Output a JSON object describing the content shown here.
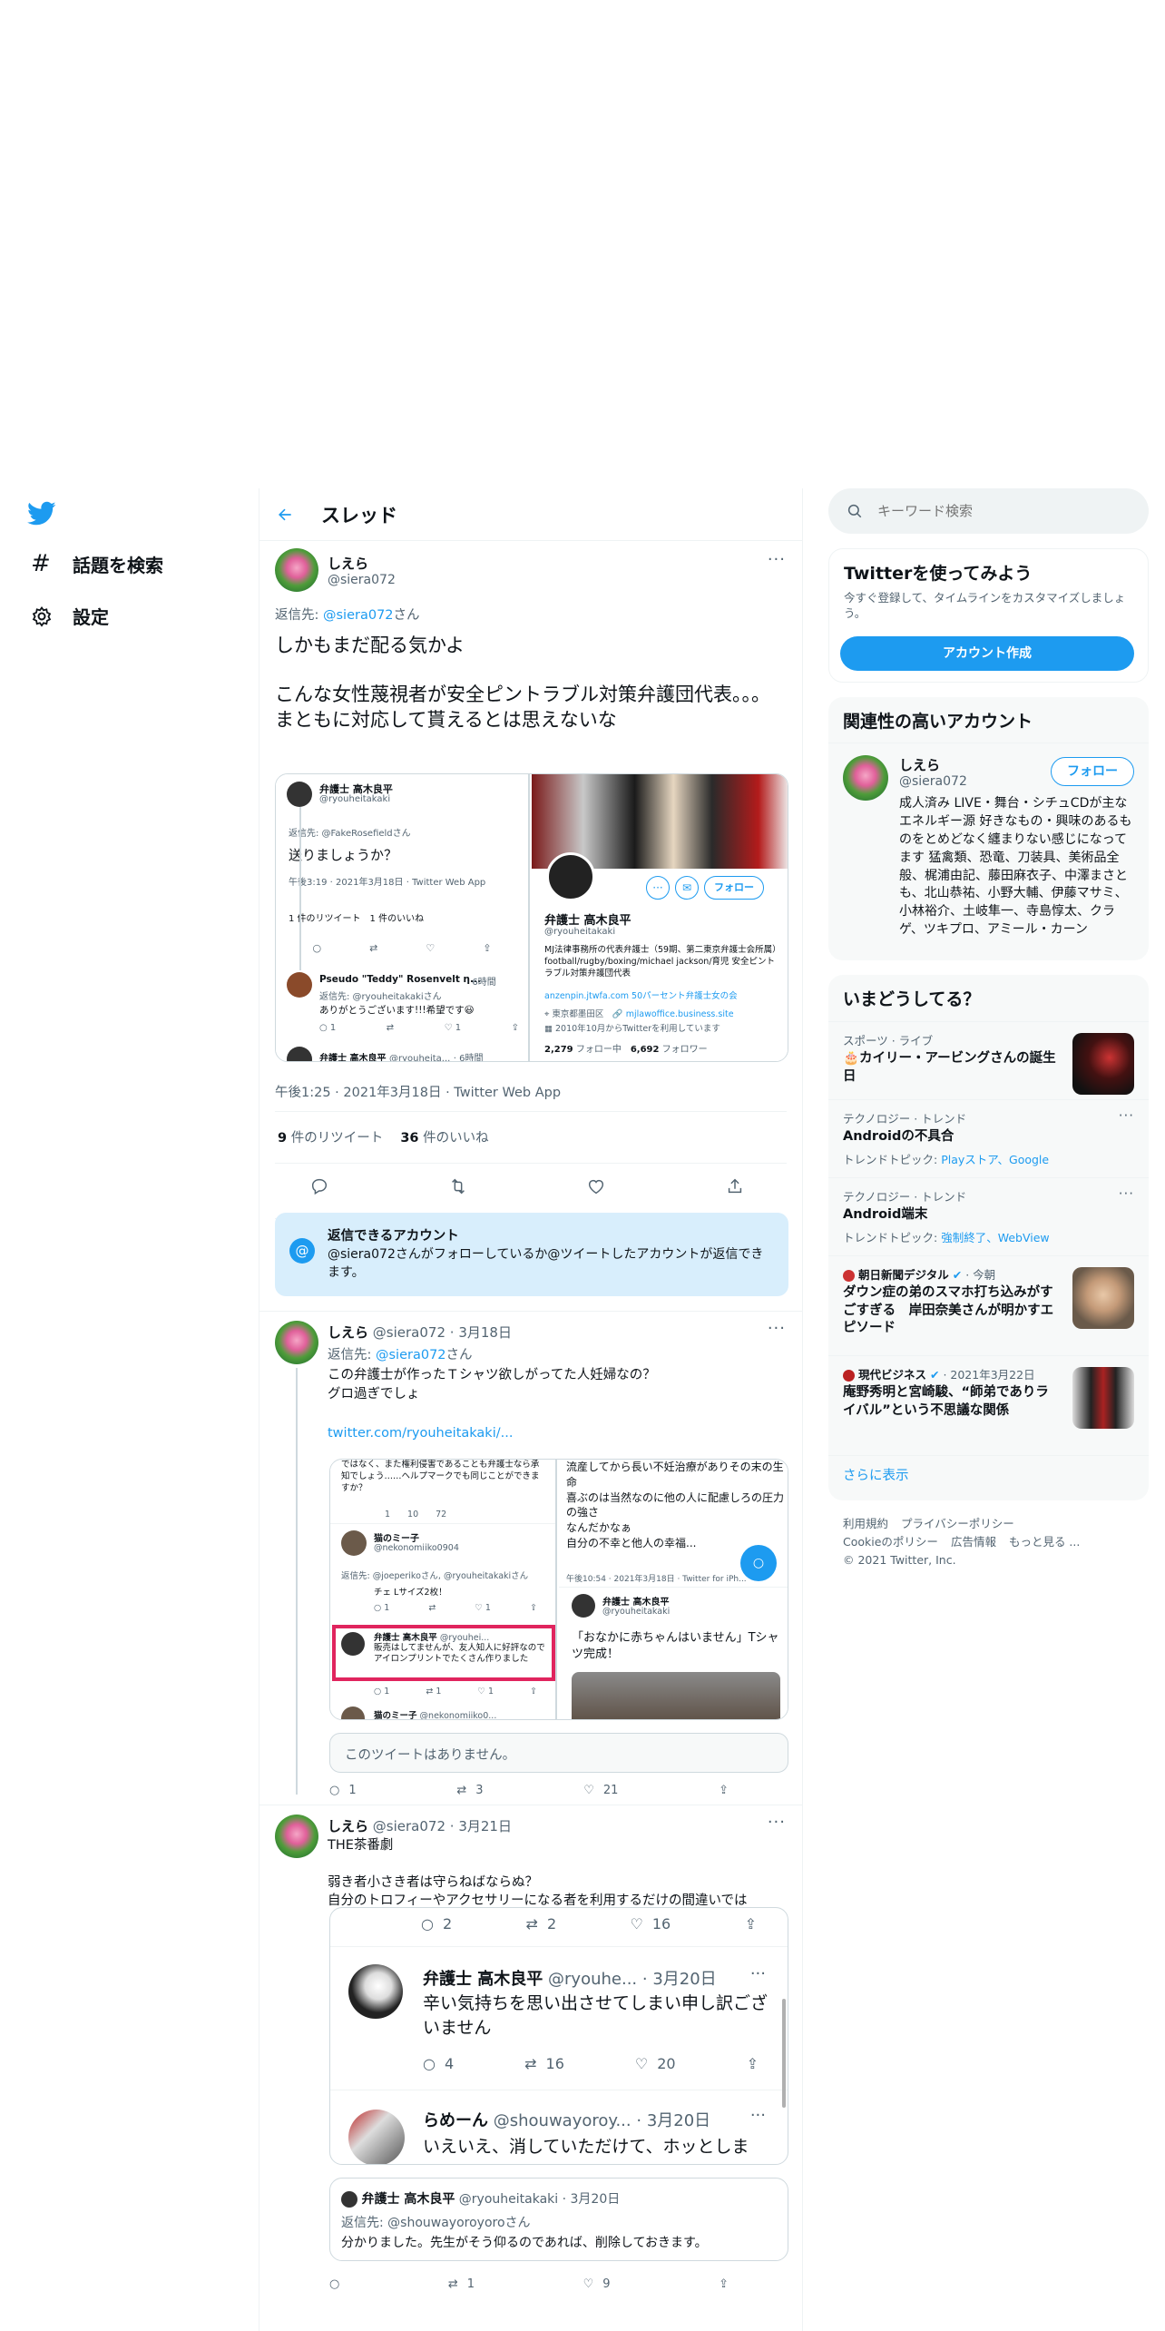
{
  "nav": {
    "explore": "話題を検索",
    "settings": "設定"
  },
  "header": {
    "title": "スレッド"
  },
  "main_tweet": {
    "name": "しえら",
    "handle": "@siera072",
    "reply_prefix": "返信先: ",
    "reply_to": "@siera072",
    "reply_suffix": "さん",
    "text_line1": "しかもまだ配る気かよ",
    "text_line2": "こんな女性蔑視者が安全ピントラブル対策弁護団代表。。。",
    "text_line3": "まともに対応して貰えるとは思えないな",
    "timestamp": "午後1:25 · 2021年3月18日 · Twitter Web App",
    "retweets": "9",
    "retweets_label": "件のリツイート",
    "likes": "36",
    "likes_label": "件のいいね",
    "embedded": {
      "left": {
        "name": "弁護士 高木良平",
        "handle": "@ryouheitakaki",
        "reply": "返信先: @FakeRosefieldさん",
        "text": "送りましょうか？",
        "time": "午後3:19 · 2021年3月18日 · Twitter Web App",
        "stats": "1 件のリツイート　1 件のいいね",
        "reply2_name": "Pseudo \"Teddy\" Rosenvelt η...",
        "reply2_time": "· 6時間",
        "reply2_reply": "返信先: @ryouheitakakiさん",
        "reply2_text": "ありがとうございます!!!希望です😃",
        "reply3_name": "弁護士 高木良平",
        "reply3_handle": "@ryouheita...",
        "reply3_time": "· 6時間"
      },
      "right": {
        "follow": "フォロー",
        "name": "弁護士 高木良平",
        "handle": "@ryouheitakaki",
        "bio": "MJ法律事務所の代表弁護士（59期、第二東京弁護士会所属）football/rugby/boxing/michael jackson/育児 安全ピントラブル対策弁護団代表",
        "links": "anzenpin.jtwfa.com 50パーセント弁護士女の会",
        "location": "東京都墨田区",
        "site": "mjlawoffice.business.site",
        "joined": "2010年10月からTwitterを利用しています",
        "following": "2,279",
        "following_label": "フォロー中",
        "followers": "6,692",
        "followers_label": "フォロワー"
      }
    }
  },
  "reply_notice": {
    "title": "返信できるアカウント",
    "text": "@siera072さんがフォローしているか@ツイートしたアカウントが返信できます。"
  },
  "reply1": {
    "name": "しえら",
    "handle": "@siera072",
    "date": "· 3月18日",
    "reply_prefix": "返信先: ",
    "reply_to": "@siera072",
    "reply_suffix": "さん",
    "text1": "この弁護士が作ったＴシャツ欲しがってた人妊婦なの？",
    "text2": "グロ過ぎでしょ",
    "link": "twitter.com/ryouheitakaki/...",
    "embed": {
      "left_top": "ではなく、また権利侵害であることも弁護士なら承知でしょう……ヘルプマークでも同じことができますか？",
      "left_stats": "1　　10　　72",
      "user2_name": "猫のミー子",
      "user2_handle": "@nekonomiiko0904",
      "user2_reply": "返信先: @joeperikoさん, @ryouheitakakiさん",
      "user2_text": "チェ Lサイズ2枚！",
      "highlight_name": "弁護士 高木良平",
      "highlight_handle": "@ryouhei...",
      "highlight_text": "販売はしてませんが、友人知人に好評なのでアイロンプリントでたくさん作りました",
      "bottom_name": "猫のミー子",
      "bottom_handle": "@nekonomiiko0...",
      "right_top1": "流産してから長い不妊治療がありその末の生命",
      "right_top2": "喜ぶのは当然なのに他の人に配慮しろの圧力の強さ",
      "right_top3": "なんだかなぁ",
      "right_top4": "自分の不幸と他人の幸福...",
      "right_time": "午後10:54 · 2021年3月18日 · Twitter for iPh...",
      "right_name": "弁護士 高木良平",
      "right_handle": "@ryouheitakaki",
      "right_text": "「おなかに赤ちゃんはいません」Tシャツ完成！"
    },
    "unavailable": "このツイートはありません。",
    "replies": "1",
    "retweets": "3",
    "likes": "21"
  },
  "reply2": {
    "name": "しえら",
    "handle": "@siera072",
    "date": "· 3月21日",
    "text1": "THE茶番劇",
    "text2": "弱き者小さき者は守らねばならぬ？",
    "text3": "自分のトロフィーやアクセサリーになる者を利用するだけの間違いでは",
    "embed": {
      "top_replies": "2",
      "top_retweets": "2",
      "top_likes": "16",
      "t1_name": "弁護士 高木良平",
      "t1_handle": "@ryouhe...",
      "t1_date": "· 3月20日",
      "t1_text": "辛い気持ちを思い出させてしまい申し訳ございません",
      "t1_replies": "4",
      "t1_retweets": "16",
      "t1_likes": "20",
      "t2_name": "らめーん",
      "t2_handle": "@shouwayoroy...",
      "t2_date": "· 3月20日",
      "t2_text": "いえいえ、消していただけて、ホッとしま"
    },
    "quote": {
      "name": "弁護士 高木良平",
      "handle": "@ryouheitakaki",
      "date": "· 3月20日",
      "reply": "返信先: @shouwayoroyoroさん",
      "text": "分かりました。先生がそう仰るのであれば、削除しておきます。"
    },
    "retweets": "1",
    "likes": "9"
  },
  "search": {
    "placeholder": "キーワード検索"
  },
  "signup": {
    "title": "Twitterを使ってみよう",
    "text": "今すぐ登録して、タイムラインをカスタマイズしましょう。",
    "button": "アカウント作成"
  },
  "relevant": {
    "title": "関連性の高いアカウント",
    "name": "しえら",
    "handle": "@siera072",
    "follow": "フォロー",
    "bio": "成人済み LIVE・舞台・シチュCDが主なエネルギー源 好きなもの・興味のあるものをとめどなく纏まりない感じになってます 猛禽類、恐竜、刀装具、美術品全般、梶浦由記、藤田麻衣子、中澤まさとも、北山恭祐、小野大輔、伊藤マサミ、小林裕介、土岐隼一、寺島惇太、クラゲ、ツキプロ、アミール・カーン"
  },
  "trends": {
    "title": "いまどうしてる？",
    "items": [
      {
        "meta": "スポーツ · ライブ",
        "name": "🎂カイリー・アービングさんの誕生日"
      },
      {
        "meta": "テクノロジー · トレンド",
        "name": "Androidの不具合",
        "sub_prefix": "トレンドトピック: ",
        "sub": "Playストア、Google"
      },
      {
        "meta": "テクノロジー · トレンド",
        "name": "Android端末",
        "sub_prefix": "トレンドトピック: ",
        "sub": "強制終了、WebView"
      },
      {
        "source": "朝日新聞デジタル",
        "meta": "· 今朝",
        "name": "ダウン症の弟のスマホ打ち込みがすごすぎる　岸田奈美さんが明かすエピソード"
      },
      {
        "source": "現代ビジネス",
        "meta": "· 2021年3月22日",
        "name": "庵野秀明と宮崎駿、“師弟でありライバル”という不思議な関係"
      }
    ],
    "more": "さらに表示"
  },
  "footer": {
    "terms": "利用規約",
    "privacy": "プライバシーポリシー",
    "cookie": "Cookieのポリシー",
    "ads": "広告情報",
    "more": "もっと見る ...",
    "copyright": "© 2021 Twitter, Inc."
  },
  "colors": {
    "accent": "#1d9bf0",
    "text": "#0f1419",
    "muted": "#536471",
    "notice_bg": "#d8eefc",
    "highlight": "#e0245e"
  }
}
